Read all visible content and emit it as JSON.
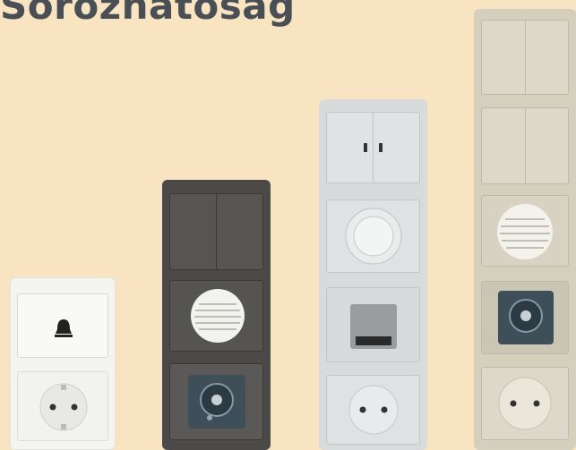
{
  "header": {
    "title": "Sorozhatóság"
  },
  "colors": {
    "background": "#f8e4c0",
    "white_frame": "#f4f4f1",
    "anthracite_frame": "#4b4a48",
    "aluminium_frame": "#d8dbdc",
    "champagne_frame": "#d5cfbe",
    "title_text": "#4a4f55"
  },
  "frames": [
    {
      "name": "white",
      "modules": [
        "bell-push-button",
        "schuko-socket"
      ]
    },
    {
      "name": "anthracite",
      "modules": [
        "double-rocker-switch",
        "speaker",
        "radio-remote-sensor"
      ]
    },
    {
      "name": "aluminium",
      "modules": [
        "double-rocker-switch",
        "thermostat-dial",
        "motion-sensor",
        "schuko-socket"
      ]
    },
    {
      "name": "champagne",
      "modules": [
        "double-rocker-switch",
        "double-rocker-switch",
        "speaker",
        "radio-remote-sensor",
        "schuko-socket"
      ]
    }
  ]
}
